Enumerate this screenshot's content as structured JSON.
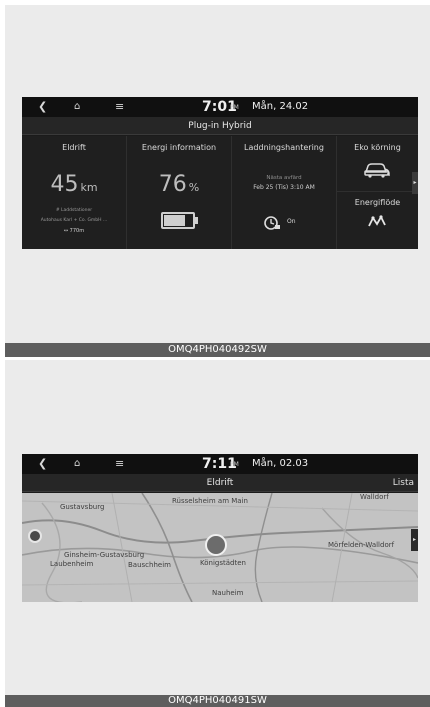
{
  "screens": [
    {
      "statusbar": {
        "time": "7:01",
        "ampm": "PM",
        "date": "Mån, 24.02"
      },
      "title": "Plug-in Hybrid",
      "tiles": {
        "eldrift": {
          "label": "Eldrift",
          "range_value": "45",
          "range_unit": "km",
          "stations_label": "# Laddstationer",
          "station_name": "Autohaus Karl + Co. GmbH ...",
          "station_distance": "↔ 770m"
        },
        "energi": {
          "label": "Energi information",
          "value": "76",
          "unit": "%",
          "battery_level": 0.76
        },
        "laddning": {
          "label": "Laddningshantering",
          "next_departure_label": "Nästa avfärd",
          "next_departure_time": "Feb 25 (Tis) 3:10 AM",
          "charging_state": "On"
        },
        "eko": {
          "label": "Eko körning",
          "flow_label": "Energiflöde"
        }
      },
      "caption": "OMQ4PH040492SW"
    },
    {
      "statusbar": {
        "time": "7:11",
        "ampm": "PM",
        "date": "Mån, 02.03"
      },
      "title": "Eldrift",
      "list_button": "Lista",
      "map_labels": {
        "gustavsburg": "Gustavsburg",
        "russelsheim": "Rüsselsheim am Main",
        "walldorf": "Walldorf",
        "ginsheim": "Ginsheim-Gustavsburg",
        "laubenheim": "Laubenheim",
        "bauschheim": "Bauschheim",
        "konigstadten": "Königstädten",
        "morfelden": "Mörfelden-Walldorf",
        "nauheim": "Nauheim"
      },
      "caption": "OMQ4PH040491SW"
    }
  ],
  "colors": {
    "screen_bg": "#1b1b1b",
    "map_bg": "#c3c3c3",
    "caption_bg": "#5e5e5e"
  },
  "icons": {
    "back": "back-chevron-icon",
    "home": "home-icon",
    "menu": "menu-icon",
    "battery": "battery-icon",
    "charge": "charge-timer-icon",
    "car": "eco-car-icon",
    "flow": "energy-flow-icon"
  }
}
